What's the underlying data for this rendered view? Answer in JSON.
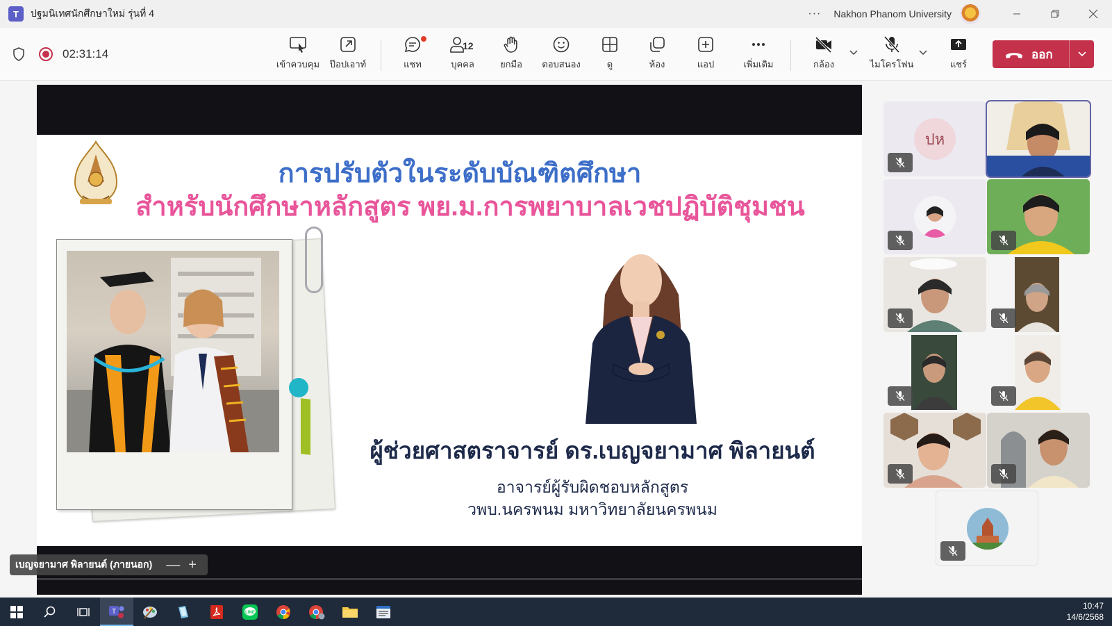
{
  "window": {
    "title": "ปฐมนิเทศนักศึกษาใหม่ รุ่นที่ 4",
    "organization": "Nakhon Phanom University",
    "more_label": "···"
  },
  "toolbar": {
    "timer": "02:31:14",
    "buttons": [
      {
        "label": "เข้าควบคุม",
        "icon": "take-control-icon"
      },
      {
        "label": "ป๊อปเอาท์",
        "icon": "popout-icon"
      },
      {
        "label": "แชท",
        "icon": "chat-icon"
      },
      {
        "label": "บุคคล",
        "icon": "people-icon",
        "count": "12"
      },
      {
        "label": "ยกมือ",
        "icon": "raise-hand-icon"
      },
      {
        "label": "ตอบสนอง",
        "icon": "react-icon"
      },
      {
        "label": "ดู",
        "icon": "view-icon"
      },
      {
        "label": "ห้อง",
        "icon": "rooms-icon"
      },
      {
        "label": "แอป",
        "icon": "apps-icon"
      },
      {
        "label": "เพิ่มเติม",
        "icon": "more-icon"
      },
      {
        "label": "กล้อง",
        "icon": "camera-off-icon"
      },
      {
        "label": "ไมโครโฟน",
        "icon": "mic-off-icon"
      },
      {
        "label": "แชร์",
        "icon": "share-icon"
      }
    ],
    "leave_label": "ออก",
    "accent_color": "#c4314b"
  },
  "slide": {
    "title_line1": "การปรับตัวในระดับบัณฑิตศึกษา",
    "title_line2": "สำหรับนักศึกษาหลักสูตร พย.ม.การพยาบาลเวชปฏิบัติชุมชน",
    "presenter_name": "ผู้ช่วยศาสตราจารย์ ดร.เบญจยามาศ พิลายนต์",
    "presenter_role_line1": "อาจารย์ผู้รับผิดชอบหลักสูตร",
    "presenter_role_line2": "วพบ.นครพนม มหาวิทยาลัยนครพนม",
    "title1_color": "#3d6ec8",
    "title2_color": "#e8559a"
  },
  "stage": {
    "speaker_name": "เบญจยามาศ พิลายนต์ (ภายนอก)",
    "zoom_out": "—",
    "zoom_in": "+"
  },
  "participants": [
    {
      "initials": "ปห",
      "muted": true
    },
    {
      "muted": false,
      "active": true
    },
    {
      "muted": true
    },
    {
      "muted": true
    },
    {
      "muted": true
    },
    {
      "muted": true
    },
    {
      "muted": true
    },
    {
      "muted": true
    },
    {
      "muted": true
    },
    {
      "muted": true
    },
    {
      "muted": true
    }
  ],
  "taskbar": {
    "time": "10:47",
    "date": "14/6/2568"
  }
}
